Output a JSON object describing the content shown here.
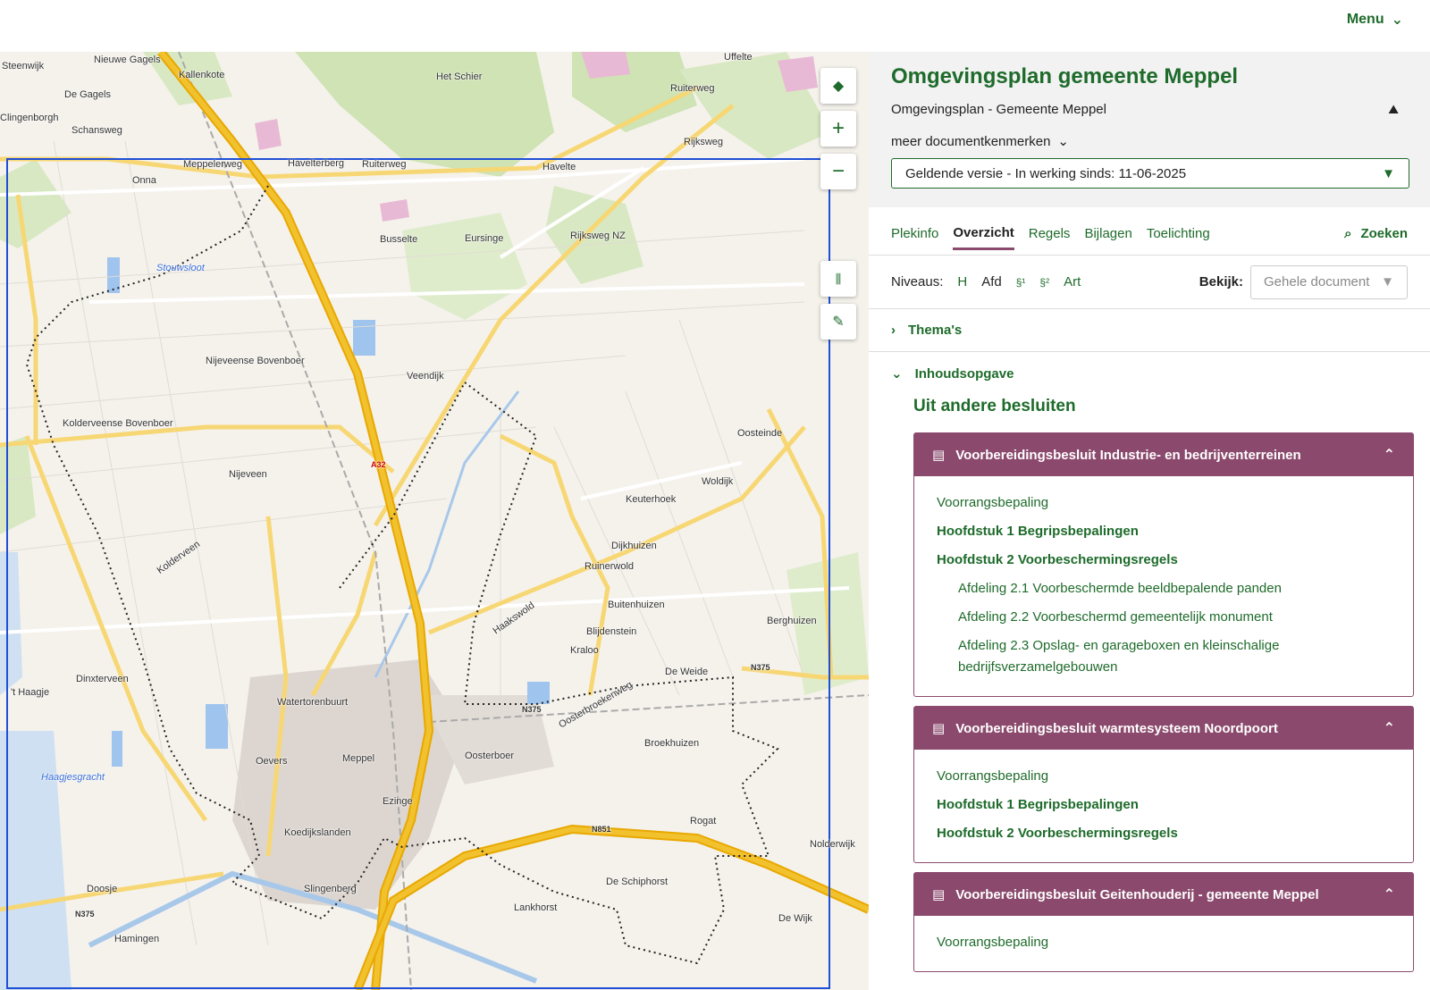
{
  "topbar": {
    "menu_label": "Menu"
  },
  "map": {
    "labels": [
      {
        "text": "Steenwijk"
      },
      {
        "text": "Nieuwe Gagels"
      },
      {
        "text": "De Gagels"
      },
      {
        "text": "Clingenborgh"
      },
      {
        "text": "Schansweg"
      },
      {
        "text": "Kallenkote"
      },
      {
        "text": "Het Schier"
      },
      {
        "text": "Uffelte"
      },
      {
        "text": "Ruiterweg"
      },
      {
        "text": "Havelterberg"
      },
      {
        "text": "Ruiterweg"
      },
      {
        "text": "Havelte"
      },
      {
        "text": "Onna"
      },
      {
        "text": "Meppelerweg"
      },
      {
        "text": "Busselte"
      },
      {
        "text": "Eursinge"
      },
      {
        "text": "Rijksweg NZ"
      },
      {
        "text": "Rijksweg"
      },
      {
        "text": "Stouwsloot",
        "water": true
      },
      {
        "text": "Nijeveense Bovenboer"
      },
      {
        "text": "Kolderveense Bovenboer"
      },
      {
        "text": "Nijeveen"
      },
      {
        "text": "Veendijk"
      },
      {
        "text": "Oosteinde"
      },
      {
        "text": "Keuterhoek"
      },
      {
        "text": "Woldijk"
      },
      {
        "text": "Dijkhuizen"
      },
      {
        "text": "Ruinerwold"
      },
      {
        "text": "Buitenhuizen"
      },
      {
        "text": "Blijdenstein"
      },
      {
        "text": "Kraloo"
      },
      {
        "text": "De Weide"
      },
      {
        "text": "Berghuizen"
      },
      {
        "text": "Dinxterveen"
      },
      {
        "text": "'t Haagje"
      },
      {
        "text": "Watertorenbuurt"
      },
      {
        "text": "Oevers"
      },
      {
        "text": "Meppel"
      },
      {
        "text": "Oosterboer"
      },
      {
        "text": "Broekhuizen"
      },
      {
        "text": "Haagjesgracht",
        "water": true
      },
      {
        "text": "Ezinge"
      },
      {
        "text": "Koedijkslanden"
      },
      {
        "text": "Rogat"
      },
      {
        "text": "Doosje"
      },
      {
        "text": "Slingenberg"
      },
      {
        "text": "De Schiphorst"
      },
      {
        "text": "Lankhorst"
      },
      {
        "text": "De Wijk"
      },
      {
        "text": "Hamingen"
      },
      {
        "text": "Nolderwijk"
      },
      {
        "text": "N375"
      },
      {
        "text": "N375"
      },
      {
        "text": "N851"
      },
      {
        "text": "N375"
      },
      {
        "text": "A32"
      },
      {
        "text": "Haakswold"
      },
      {
        "text": "Oosterbroekenweg"
      },
      {
        "text": "Kolderveen"
      }
    ],
    "controls": [
      {
        "name": "layers-icon",
        "glyph": "◆"
      },
      {
        "name": "zoom-in-icon",
        "glyph": "+"
      },
      {
        "name": "zoom-out-icon",
        "glyph": "−"
      },
      {
        "name": "measure-icon",
        "glyph": "⊥"
      },
      {
        "name": "draw-icon",
        "glyph": "✎"
      }
    ]
  },
  "panel": {
    "title": "Omgevingsplan gemeente Meppel",
    "subtitle": "Omgevingsplan - Gemeente Meppel",
    "meer_label": "meer documentkenmerken",
    "version_select": "Geldende versie - In werking sinds: 11-06-2025",
    "tabs": [
      "Plekinfo",
      "Overzicht",
      "Regels",
      "Bijlagen",
      "Toelichting"
    ],
    "zoeken_label": "Zoeken",
    "niveaus_label": "Niveaus:",
    "niveaus": [
      "H",
      "Afd",
      "§¹",
      "§²",
      "Art"
    ],
    "bekijk_label": "Bekijk:",
    "bekijk_value": "Gehele document",
    "themas_label": "Thema's",
    "inhoud_label": "Inhoudsopgave",
    "section_title": "Uit andere besluiten",
    "cards": [
      {
        "title": "Voorbereidingsbesluit Industrie- en bedrijventerreinen",
        "links": [
          {
            "text": "Voorrangsbepaling",
            "style": ""
          },
          {
            "text": "Hoofdstuk 1 Begripsbepalingen",
            "style": "bold"
          },
          {
            "text": "Hoofdstuk 2 Voorbeschermingsregels",
            "style": "bold"
          },
          {
            "text": "Afdeling 2.1 Voorbeschermde beeldbepalende panden",
            "style": "indent"
          },
          {
            "text": "Afdeling 2.2 Voorbeschermd gemeentelijk monument",
            "style": "indent"
          },
          {
            "text": "Afdeling 2.3 Opslag- en garageboxen en kleinschalige bedrijfsverzamelgebouwen",
            "style": "indent"
          }
        ]
      },
      {
        "title": "Voorbereidingsbesluit warmtesysteem Noordpoort",
        "links": [
          {
            "text": "Voorrangsbepaling",
            "style": ""
          },
          {
            "text": "Hoofdstuk 1 Begripsbepalingen",
            "style": "bold"
          },
          {
            "text": "Hoofdstuk 2 Voorbeschermingsregels",
            "style": "bold"
          }
        ]
      },
      {
        "title": "Voorbereidingsbesluit Geitenhouderij - gemeente Meppel",
        "links": [
          {
            "text": "Voorrangsbepaling",
            "style": ""
          }
        ]
      }
    ]
  },
  "colors": {
    "brand_green": "#1e6b2b",
    "card_purple": "#8b4a6d",
    "selection_blue": "#1f4fd6",
    "road_yellow": "#f2c12e"
  }
}
